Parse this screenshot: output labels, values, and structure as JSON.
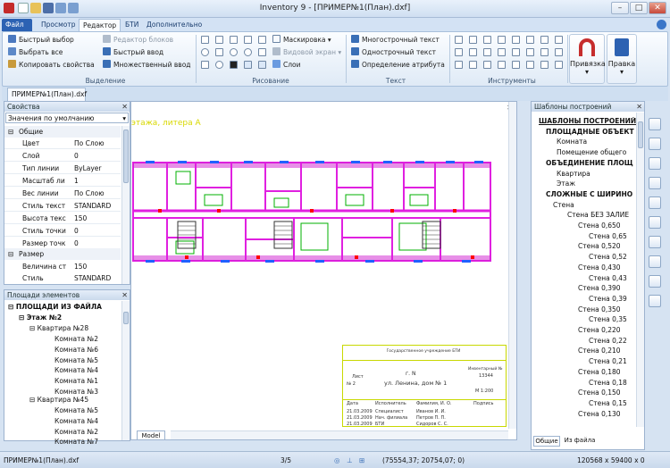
{
  "window": {
    "title": "Inventory 9 - [ПРИМЕР№1(План).dxf]",
    "min": "–",
    "max": "□",
    "close": "✕"
  },
  "tabs": [
    "Файл",
    "Просмотр",
    "Редактор",
    "БТИ",
    "Дополнительно"
  ],
  "ribbon": {
    "selection": {
      "items": [
        "Быстрый выбор",
        "Выбрать все",
        "Копировать свойства",
        "Редактор блоков",
        "Быстрый ввод",
        "Множественный ввод"
      ],
      "label": "Выделение"
    },
    "drawing": {
      "items": [
        "Маскировка",
        "Видовой экран",
        "Слои"
      ],
      "label": "Рисование"
    },
    "text": {
      "items": [
        "Многострочный текст",
        "Однострочный текст",
        "Определение атрибута"
      ],
      "label": "Текст"
    },
    "tools": {
      "label": "Инструменты"
    },
    "binding": "Привязка",
    "help": "Правка"
  },
  "doctab": "ПРИМЕР№1(План).dxf",
  "properties": {
    "title": "Свойства",
    "dropdown": "Значения по умолчанию",
    "group_general": "Общие",
    "rows": [
      {
        "name": "Цвет",
        "value": "По Слою"
      },
      {
        "name": "Слой",
        "value": "0"
      },
      {
        "name": "Тип линии",
        "value": "ByLayer"
      },
      {
        "name": "Масштаб ли",
        "value": "1"
      },
      {
        "name": "Вес линии",
        "value": "По Слою"
      },
      {
        "name": "Стиль текст",
        "value": "STANDARD"
      },
      {
        "name": "Высота текс",
        "value": "150"
      },
      {
        "name": "Стиль точки",
        "value": "0"
      },
      {
        "name": "Размер точк",
        "value": "0"
      }
    ],
    "group_size": "Размер",
    "rows2": [
      {
        "name": "Величина ст",
        "value": "150"
      },
      {
        "name": "Стиль",
        "value": "STANDARD"
      }
    ]
  },
  "areas": {
    "title": "Площади элементов",
    "root": "ПЛОЩАДИ ИЗ ФАЙЛА",
    "floor": "Этаж №2",
    "apt1": "Квартира №28",
    "rooms1": [
      "Комната №2",
      "Комната №6",
      "Комната №5",
      "Комната №4",
      "Комната №1",
      "Комната №3"
    ],
    "apt2": "Квартира №45",
    "rooms2": [
      "Комната №5",
      "Комната №4",
      "Комната №2",
      "Комната №7"
    ]
  },
  "templates": {
    "title": "Шаблоны построений",
    "items": [
      "ШАБЛОНЫ ПОСТРОЕНИЙ",
      "ПЛОЩАДНЫЕ ОБЪЕКТ",
      "Комната",
      "Помещение общего",
      "ОБЪЕДИНЕНИЕ ПЛОЩ",
      "Квартира",
      "Этаж",
      "СЛОЖНЫЕ С ШИРИНО",
      "Стена",
      "Стена БЕЗ ЗАЛИЕ",
      "Стена 0,650",
      "Стена 0,65",
      "Стена 0,520",
      "Стена 0,52",
      "Стена 0,430",
      "Стена 0,43",
      "Стена 0,390",
      "Стена 0,39",
      "Стена 0,350",
      "Стена 0,35",
      "Стена 0,220",
      "Стена 0,22",
      "Стена 0,210",
      "Стена 0,21",
      "Стена 0,180",
      "Стена 0,18",
      "Стена 0,150",
      "Стена 0,15",
      "Стена 0,130"
    ],
    "tab_general": "Общие",
    "tab_file": "Из файла"
  },
  "drawing": {
    "header_text": "этажа, литера А",
    "model_tab": "Model",
    "stamp": {
      "org": "Государственное учреждение БТИ",
      "city": "г. N",
      "address": "ул. Ленина, дом № 1",
      "sheet_label": "Лист",
      "sheet_no": "2",
      "inv_label": "Инвентарный №",
      "inv_no": "13344",
      "scale": "М 1:200",
      "cols": [
        "Дата",
        "Исполнитель",
        "Фамилия, И. О.",
        "Подпись"
      ],
      "rows": [
        [
          "21.03.2009",
          "Специалист",
          "Иванов И. И."
        ],
        [
          "21.03.2009",
          "Нач. филиала",
          "Петров П. П."
        ],
        [
          "21.03.2009",
          "БТИ",
          "Сидоров С. С."
        ]
      ]
    }
  },
  "status": {
    "file": "ПРИМЕР№1(План).dxf",
    "page": "3/5",
    "coords": "(75554,37; 20754,07; 0)",
    "size": "120568 x 59400 x 0"
  },
  "colors": {
    "accent": "#2c62b3",
    "wall": "#e020e0",
    "grid": "#00b000",
    "window": "#2060ff",
    "door": "#ff0000"
  }
}
